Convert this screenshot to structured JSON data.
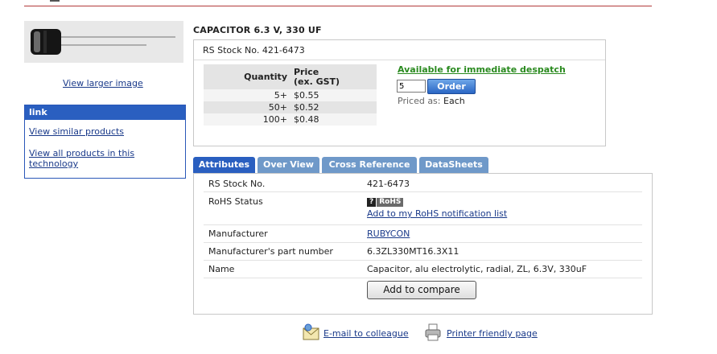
{
  "product": {
    "title": "CAPACITOR 6.3 V, 330 UF",
    "view_larger": "View larger image"
  },
  "link_box": {
    "header": "link",
    "items": [
      "View similar products",
      "View all products in this technology"
    ]
  },
  "price_box": {
    "stock_no": "RS Stock No. 421-6473",
    "quantity_header": "Quantity",
    "price_header": "Price (ex. GST)",
    "price_header_line1": "Price",
    "price_header_line2": "(ex. GST)",
    "rows": [
      {
        "qty": "5+",
        "price": "$0.55"
      },
      {
        "qty": "50+",
        "price": "$0.52"
      },
      {
        "qty": "100+",
        "price": "$0.48"
      }
    ],
    "availability": "Available for immediate despatch",
    "quantity_value": "5",
    "order_label": "Order",
    "priced_as_label": "Priced as:",
    "priced_as_value": "Each"
  },
  "tabs": [
    {
      "label": "Attributes",
      "active": true
    },
    {
      "label": "Over View",
      "active": false
    },
    {
      "label": "Cross Reference",
      "active": false
    },
    {
      "label": "DataSheets",
      "active": false
    }
  ],
  "attributes": {
    "rows": [
      {
        "label": "RS Stock No.",
        "value": "421-6473"
      },
      {
        "label": "RoHS Status",
        "badge_q": "?",
        "badge_text": "RoHS",
        "link": "Add to my RoHS notification list"
      },
      {
        "label": "Manufacturer",
        "value": "RUBYCON"
      },
      {
        "label": "Manufacturer's part number",
        "value": "6.3ZL330MT16.3X11"
      },
      {
        "label": "Name",
        "value": "Capacitor, alu electrolytic, radial, ZL, 6.3V, 330uF"
      }
    ],
    "compare_label": "Add to compare"
  },
  "footer": {
    "email_label": "E-mail to colleague",
    "print_label": "Printer friendly page"
  },
  "colors": {
    "accent_blue": "#2a5fc0",
    "tab_inactive": "#6f99c9",
    "available_green": "#2a8a1f",
    "top_rule": "#b23a3a"
  }
}
